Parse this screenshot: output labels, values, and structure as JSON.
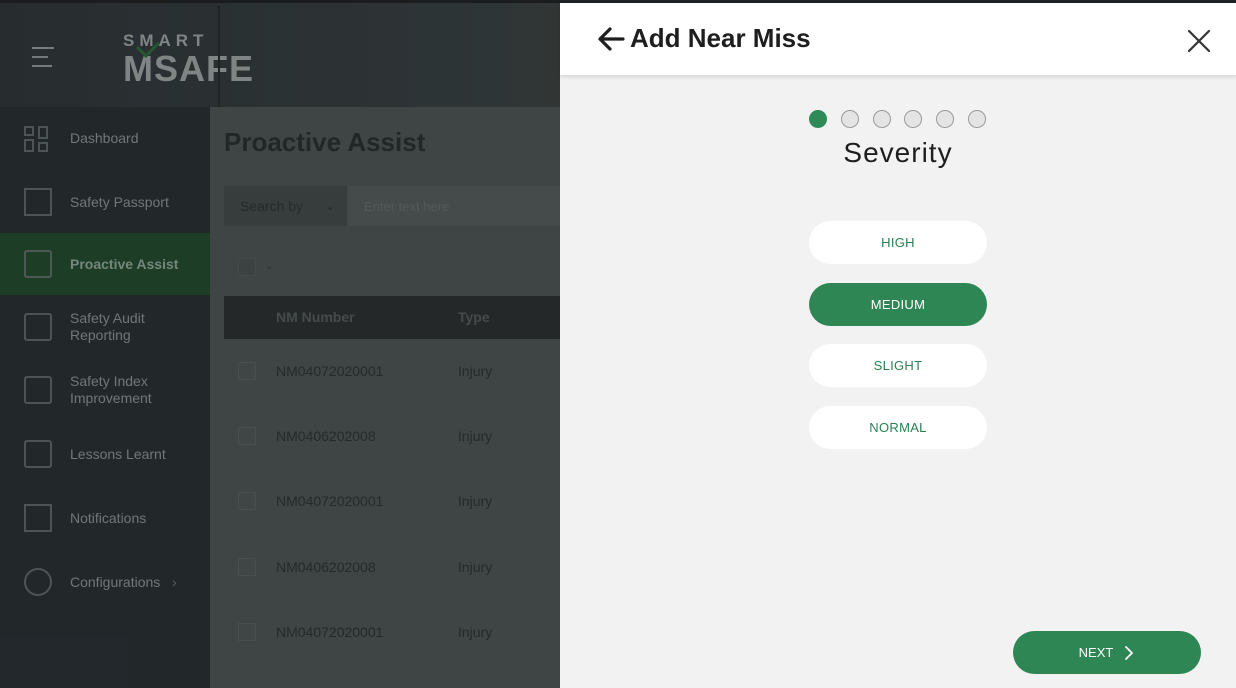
{
  "app": {
    "logo_top": "SMART",
    "logo_main": "MSAFE"
  },
  "sidebar": {
    "items": [
      {
        "label": "Dashboard",
        "icon": "dashboard-icon"
      },
      {
        "label": "Safety Passport",
        "icon": "passport-icon"
      },
      {
        "label": "Proactive Assist",
        "icon": "proactive-icon",
        "active": true
      },
      {
        "label": "Safety Audit Reporting",
        "icon": "audit-icon"
      },
      {
        "label": "Safety Index Improvement",
        "icon": "index-icon"
      },
      {
        "label": "Lessons Learnt",
        "icon": "lessons-icon"
      },
      {
        "label": "Notifications",
        "icon": "notifications-icon"
      },
      {
        "label": "Configurations",
        "icon": "configurations-icon"
      }
    ]
  },
  "main": {
    "title": "Proactive Assist",
    "search_by_label": "Search by",
    "search_placeholder": "Enter text here",
    "table": {
      "columns": [
        "NM Number",
        "Type"
      ],
      "rows": [
        [
          "NM04072020001",
          "Injury"
        ],
        [
          "NM0406202008",
          "Injury"
        ],
        [
          "NM04072020001",
          "Injury"
        ],
        [
          "NM0406202008",
          "Injury"
        ],
        [
          "NM04072020001",
          "Injury"
        ]
      ]
    }
  },
  "modal": {
    "title": "Add Near Miss",
    "step_count": 6,
    "current_step": 1,
    "step_title": "Severity",
    "options": [
      "HIGH",
      "MEDIUM",
      "SLIGHT",
      "NORMAL"
    ],
    "selected_option": "MEDIUM",
    "next_label": "NEXT"
  },
  "colors": {
    "accent": "#2e8654",
    "sidebar_active": "#244b30"
  }
}
